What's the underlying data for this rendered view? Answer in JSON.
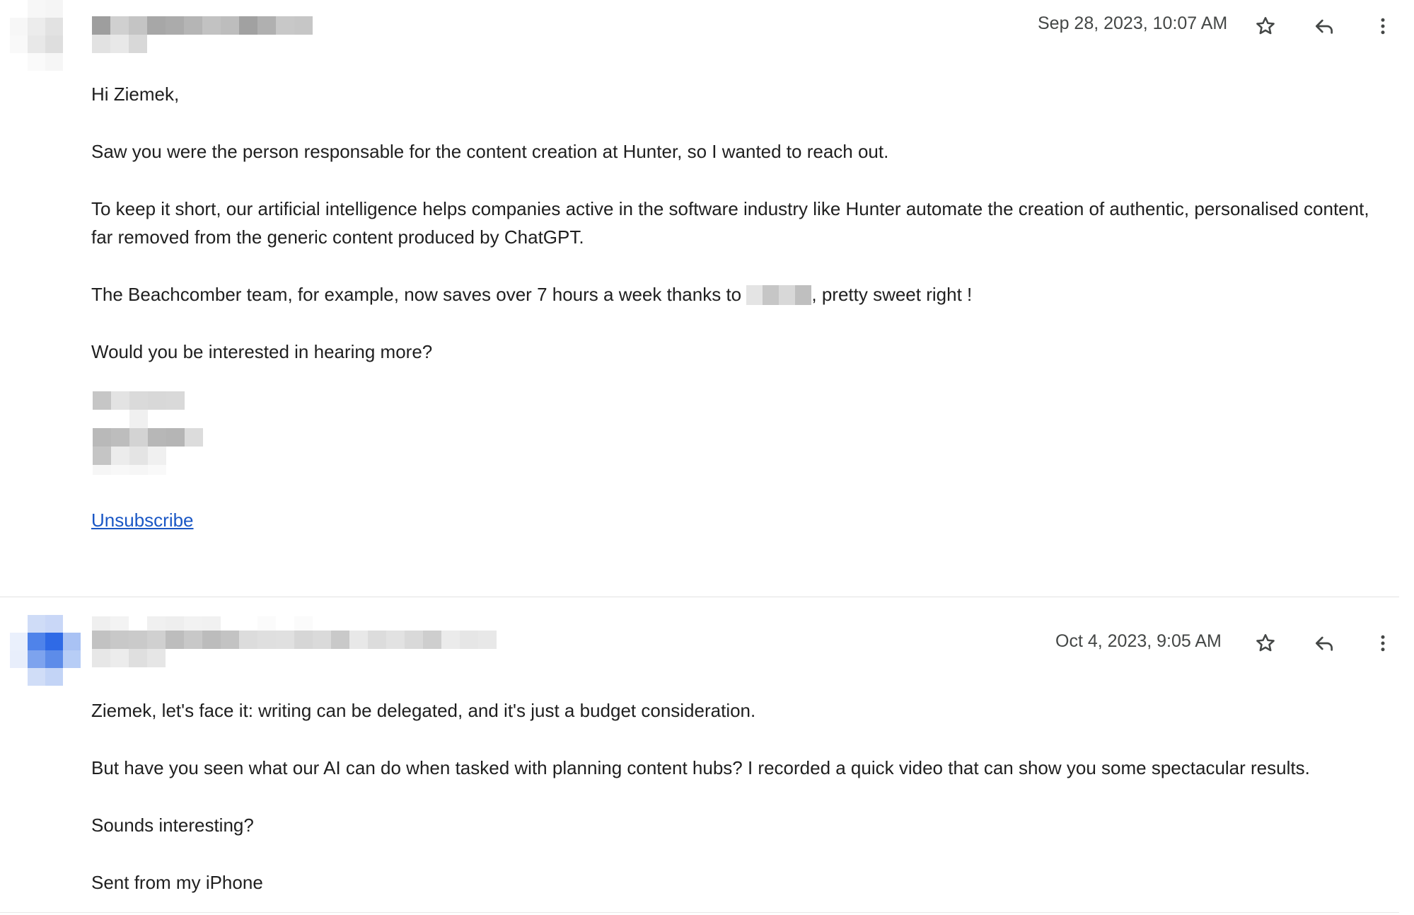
{
  "messages": [
    {
      "date": "Sep 28, 2023, 10:07 AM",
      "body": [
        "Hi Ziemek,",
        "Saw you were the person responsable for the content creation at Hunter, so I wanted to reach out.",
        "To keep it short, our artificial intelligence helps companies active in the software industry like Hunter automate the creation of authentic, personalised content, far removed from the generic content produced by ChatGPT.",
        "The Beachcomber team, for example, now saves over 7 hours a week thanks to",
        ", pretty sweet right !",
        "Would you be interested in hearing more?"
      ],
      "unsubscribe": "Unsubscribe"
    },
    {
      "date": "Oct 4, 2023, 9:05 AM",
      "body": [
        "Ziemek, let's face it: writing can be delegated, and it's just a budget consideration.",
        "But have you seen what our AI can do when tasked with planning content hubs? I recorded a quick video that can show you some spectacular results.",
        "Sounds interesting?",
        "Sent from my iPhone"
      ]
    }
  ],
  "icons": {
    "star": "star-icon",
    "reply": "reply-icon",
    "more": "more-vert-icon"
  },
  "colors": {
    "link": "#1a57c5",
    "text": "#1f1f1f",
    "meta": "#444746",
    "divider": "#e3e3e3"
  }
}
